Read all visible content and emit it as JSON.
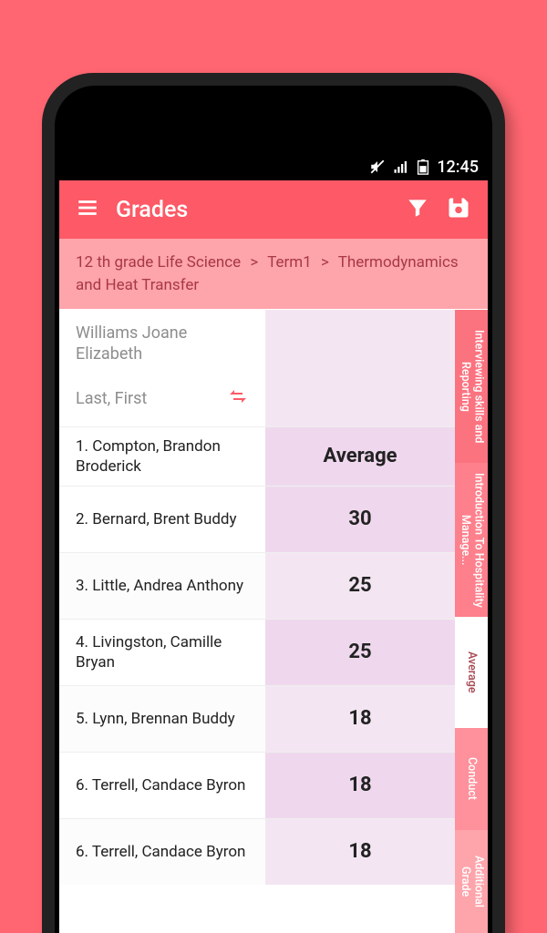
{
  "status": {
    "time": "12:45"
  },
  "header": {
    "title": "Grades"
  },
  "breadcrumb": {
    "part1": "12 th grade Life Science",
    "part2": "Term1",
    "part3": "Thermodynamics and Heat Transfer"
  },
  "teacher": "Williams Joane Elizabeth",
  "sortLabel": "Last, First",
  "columnHeader": "Average",
  "students": [
    {
      "name": "1. Compton, Brandon Broderick",
      "value": ""
    },
    {
      "name": "2. Bernard, Brent Buddy",
      "value": "30"
    },
    {
      "name": "3. Little, Andrea Anthony",
      "value": "25"
    },
    {
      "name": "4. Livingston, Camille Bryan",
      "value": "25"
    },
    {
      "name": "5. Lynn, Brennan Buddy",
      "value": "18"
    },
    {
      "name": "6. Terrell, Candace Byron",
      "value": "18"
    },
    {
      "name": "6. Terrell, Candace Byron",
      "value": "18"
    }
  ],
  "sideTabs": [
    "Interviewing skills and Reporting",
    "Introduction To Hospitality Manage...",
    "Average",
    "Conduct",
    "Additional Grade"
  ]
}
